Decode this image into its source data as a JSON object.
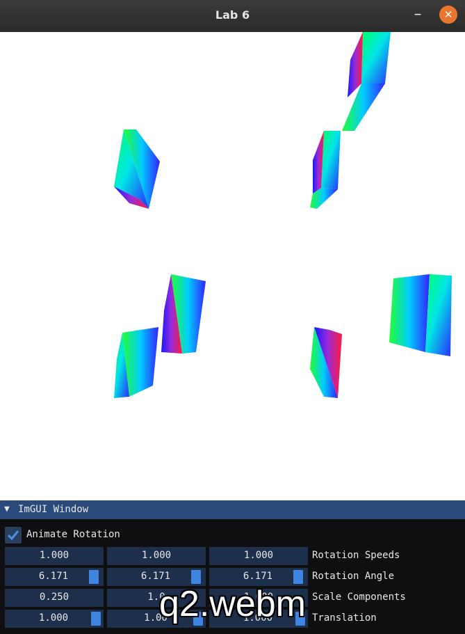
{
  "window": {
    "title": "Lab 6",
    "minimize_glyph": "–",
    "close_glyph": "✕"
  },
  "imgui": {
    "header": {
      "title": "ImGUI Window",
      "arrow_icon": "triangle-down-icon"
    },
    "animate_rotation": {
      "label": "Animate Rotation",
      "checked": true
    },
    "rows": [
      {
        "label": "Rotation Speeds",
        "values": [
          "1.000",
          "1.000",
          "1.000"
        ],
        "slider": false
      },
      {
        "label": "Rotation Angle",
        "values": [
          "6.171",
          "6.171",
          "6.171"
        ],
        "slider": true
      },
      {
        "label": "Scale Components",
        "values": [
          "0.250",
          "1.0",
          "1.000"
        ],
        "slider": false
      },
      {
        "label": "Translation",
        "values": [
          "1.000",
          "1.00",
          "1.000"
        ],
        "slider": true
      }
    ]
  },
  "video_overlay": {
    "text": "q2.webm"
  },
  "colors": {
    "accent": "#3d85e0",
    "header": "#294a7a",
    "field": "#1d2f4b",
    "close": "#e9752f"
  }
}
